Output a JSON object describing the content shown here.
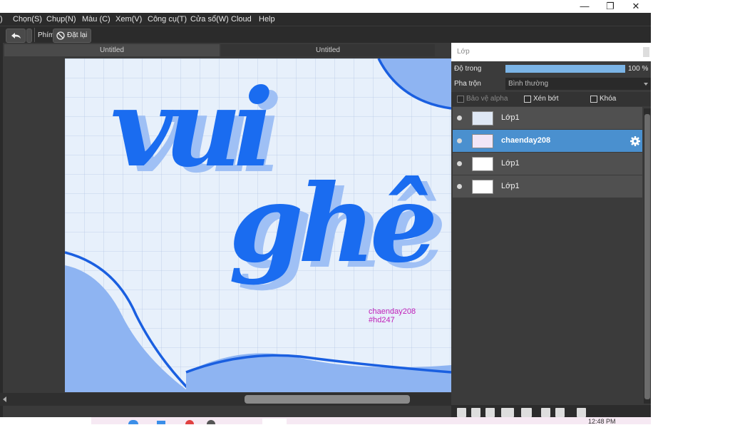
{
  "window": {
    "minimize_symbol": "—",
    "maximize_symbol": "❐",
    "close_symbol": "✕"
  },
  "menu": {
    "items": [
      "Chọn(S)",
      "Chụp(N)",
      "Màu (C)",
      "Xem(V)",
      "Công cụ(T)",
      "Cửa sổ(W)",
      "Cloud",
      "Help"
    ]
  },
  "toolbar": {
    "undo_icon": "undo-arrow-icon",
    "key_label": "Phím",
    "reset_label": "Đặt lại",
    "reset_icon": "no-sign-icon"
  },
  "documents": {
    "tabs": [
      "Untitled",
      "Untitled"
    ]
  },
  "canvas": {
    "text_line_1": "vui",
    "text_line_2": "ghê",
    "credit_name": "chaenday208",
    "credit_tag": "#hd247",
    "credit_color": "#c020b8",
    "lettering_color": "#1a6cf0",
    "shadow_color": "#7fa9f5",
    "background_color": "#e7f0fb"
  },
  "layers_panel": {
    "title": "Lớp",
    "opacity_label": "Độ trong",
    "opacity_value": "100 %",
    "opacity_fraction": 1.0,
    "blend_label": "Pha trộn",
    "blend_value": "Bình thường",
    "protect_alpha_label": "Bảo vệ alpha",
    "clipping_label": "Xén bớt",
    "lock_label": "Khóa",
    "selected_color": "#4a90cf",
    "layers": [
      {
        "name": "Lớp1",
        "selected": false
      },
      {
        "name": "chaenday208",
        "selected": true
      },
      {
        "name": "Lớp1",
        "selected": false
      },
      {
        "name": "Lớp1",
        "selected": false
      }
    ]
  },
  "taskbar": {
    "clock": "12:48 PM"
  }
}
